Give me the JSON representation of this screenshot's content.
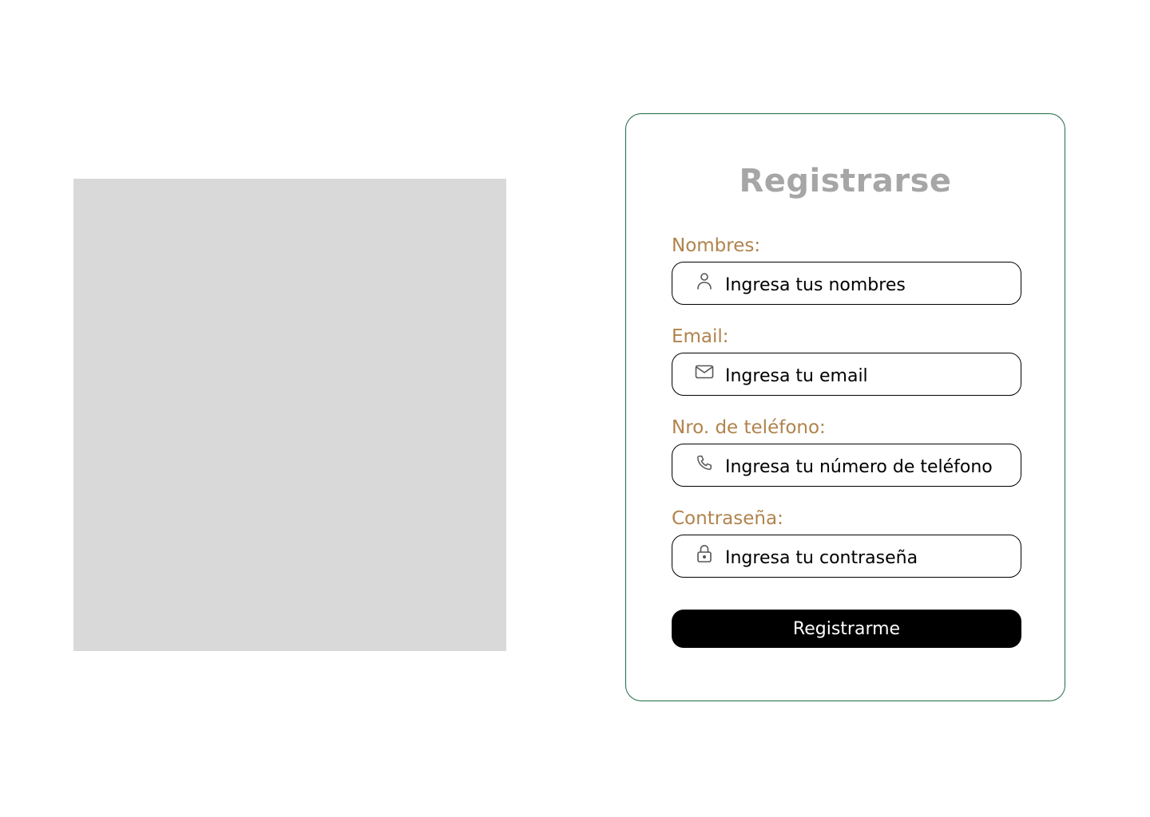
{
  "colors": {
    "title": "#a6a6a6",
    "label": "#b0834c",
    "card_border": "#1f6b45",
    "placeholder_bg": "#d9d9d9",
    "button_bg": "#000000",
    "button_text": "#ffffff",
    "icon": "#555555"
  },
  "form": {
    "title": "Registrarse",
    "fields": [
      {
        "label": "Nombres:",
        "placeholder": "Ingresa tus nombres",
        "icon": "user-icon"
      },
      {
        "label": "Email:",
        "placeholder": "Ingresa tu email",
        "icon": "mail-icon"
      },
      {
        "label": "Nro. de teléfono:",
        "placeholder": "Ingresa tu número de teléfono",
        "icon": "phone-icon"
      },
      {
        "label": "Contraseña:",
        "placeholder": "Ingresa tu contraseña",
        "icon": "lock-icon"
      }
    ],
    "submit_label": "Registrarme"
  }
}
